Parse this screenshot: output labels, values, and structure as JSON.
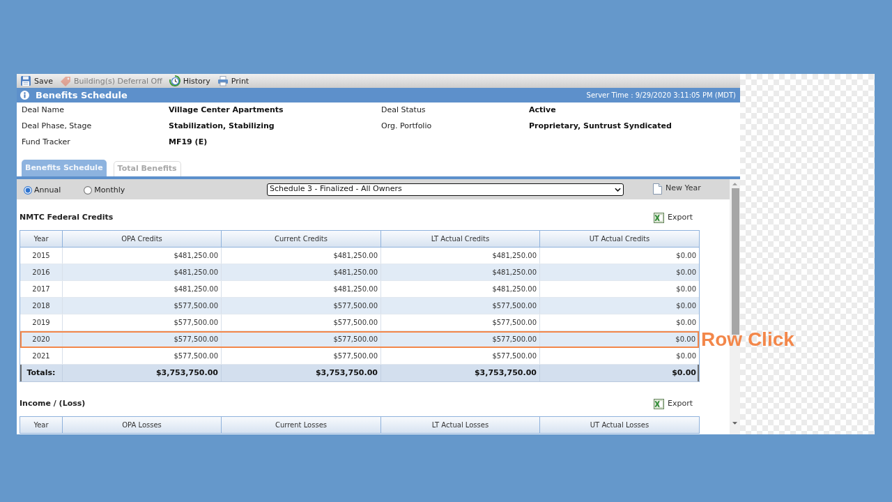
{
  "toolbar": {
    "items": [
      {
        "kind": "save",
        "label": "Save",
        "disabled": false
      },
      {
        "kind": "tag",
        "label": "Building(s) Deferral Off",
        "disabled": true
      },
      {
        "kind": "history",
        "label": "History",
        "disabled": false
      },
      {
        "kind": "print",
        "label": "Print",
        "disabled": false
      }
    ]
  },
  "title_bar": {
    "title": "Benefits Schedule",
    "server_time": "Server Time : 9/29/2020 3:11:05 PM (MDT)"
  },
  "deal_info": [
    {
      "label": "Deal Name",
      "value": "Village Center Apartments"
    },
    {
      "label": "Deal Status",
      "value": "Active"
    },
    {
      "label": "Deal Phase, Stage",
      "value": "Stabilization, Stabilizing"
    },
    {
      "label": "Org. Portfolio",
      "value": "Proprietary, Suntrust Syndicated"
    },
    {
      "label": "Fund Tracker",
      "value": "MF19 (E)"
    }
  ],
  "tabs": [
    {
      "label": "Benefits Schedule",
      "selected": true
    },
    {
      "label": "Total Benefits",
      "selected": false
    }
  ],
  "options_bar": {
    "period": [
      {
        "label": "Annual",
        "selected": true
      },
      {
        "label": "Monthly",
        "selected": false
      }
    ],
    "schedule_select": {
      "value": "Schedule 3 - Finalized - All Owners"
    },
    "new_year": "New Year"
  },
  "sections": [
    {
      "title": "NMTC Federal Credits",
      "export": "Export",
      "columns": [
        "Year",
        "OPA Credits",
        "Current Credits",
        "LT Actual Credits",
        "UT Actual Credits"
      ],
      "rows": [
        {
          "cells": [
            "2015",
            "$481,250.00",
            "$481,250.00",
            "$481,250.00",
            "$0.00"
          ],
          "highlighted": false
        },
        {
          "cells": [
            "2016",
            "$481,250.00",
            "$481,250.00",
            "$481,250.00",
            "$0.00"
          ],
          "highlighted": false
        },
        {
          "cells": [
            "2017",
            "$481,250.00",
            "$481,250.00",
            "$481,250.00",
            "$0.00"
          ],
          "highlighted": false
        },
        {
          "cells": [
            "2018",
            "$577,500.00",
            "$577,500.00",
            "$577,500.00",
            "$0.00"
          ],
          "highlighted": false
        },
        {
          "cells": [
            "2019",
            "$577,500.00",
            "$577,500.00",
            "$577,500.00",
            "$0.00"
          ],
          "highlighted": false
        },
        {
          "cells": [
            "2020",
            "$577,500.00",
            "$577,500.00",
            "$577,500.00",
            "$0.00"
          ],
          "highlighted": true
        },
        {
          "cells": [
            "2021",
            "$577,500.00",
            "$577,500.00",
            "$577,500.00",
            "$0.00"
          ],
          "highlighted": false
        }
      ],
      "totals": {
        "label": "Totals:",
        "values": [
          "$3,753,750.00",
          "$3,753,750.00",
          "$3,753,750.00",
          "$0.00"
        ]
      }
    },
    {
      "title": "Income / (Loss)",
      "export": "Export",
      "columns": [
        "Year",
        "OPA Losses",
        "Current Losses",
        "LT Actual Losses",
        "UT Actual Losses"
      ]
    }
  ],
  "callout": {
    "text": "Row Click"
  }
}
